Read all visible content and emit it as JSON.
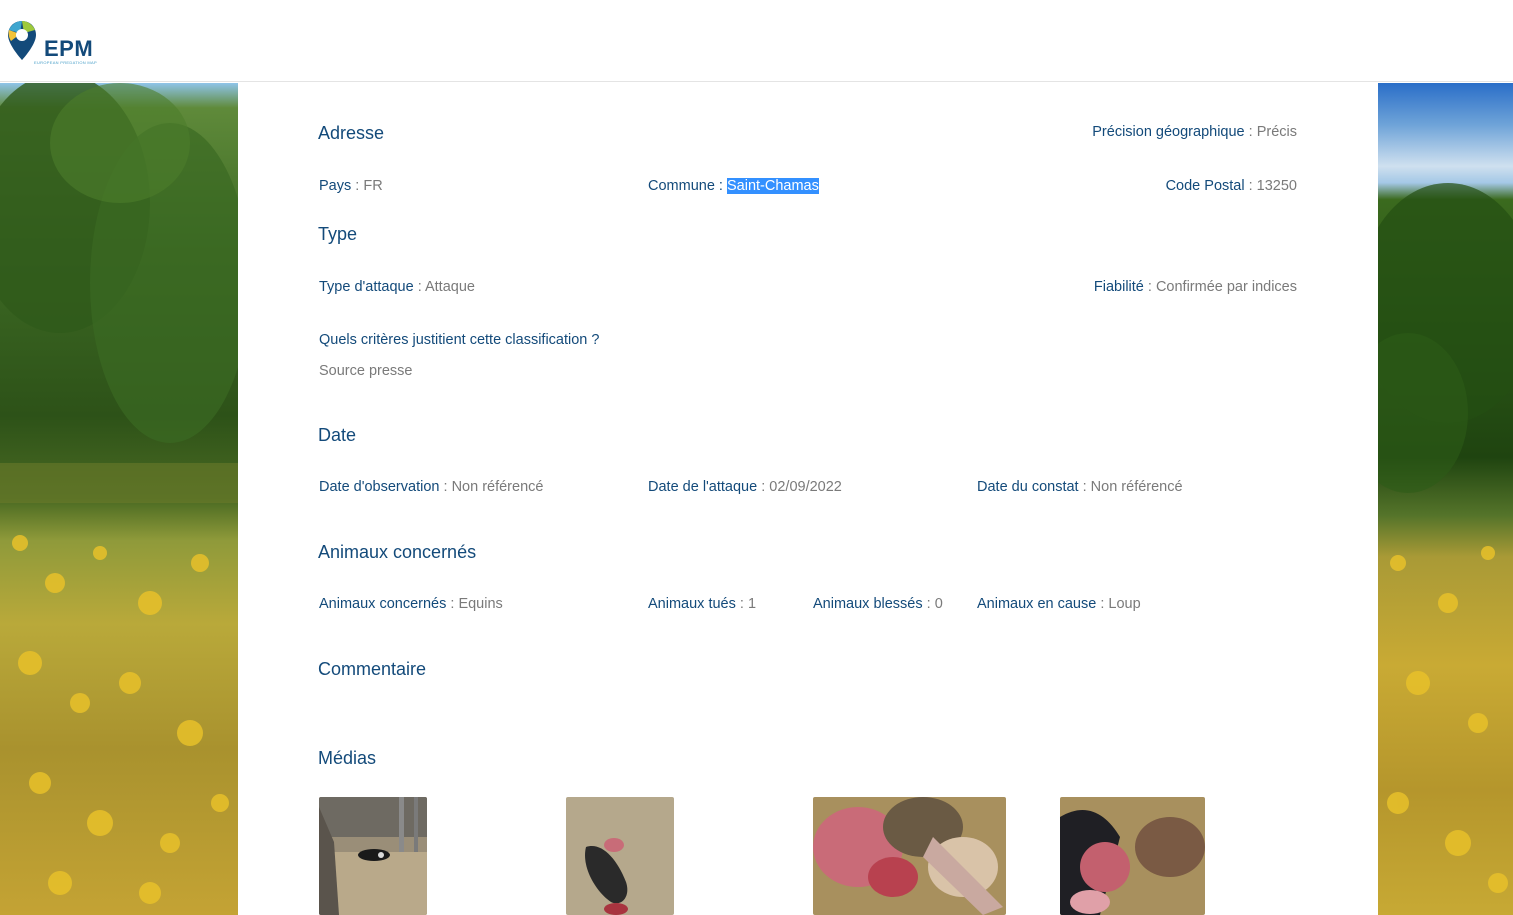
{
  "header": {
    "logo_text": "EPM",
    "logo_tagline": "EUROPEAN PREDATION MAP"
  },
  "adresse": {
    "heading": "Adresse",
    "precision_label": "Précision géographique",
    "precision_value": "Précis",
    "pays_label": "Pays",
    "pays_value": "FR",
    "commune_label": "Commune",
    "commune_value": "Saint-Chamas",
    "code_postal_label": "Code Postal",
    "code_postal_value": "13250"
  },
  "type": {
    "heading": "Type",
    "attaque_label": "Type d'attaque",
    "attaque_value": "Attaque",
    "fiabilite_label": "Fiabilité",
    "fiabilite_value": "Confirmée par indices",
    "question": "Quels critères justitient cette classification ?",
    "answer": "Source presse"
  },
  "date": {
    "heading": "Date",
    "observation_label": "Date d'observation",
    "observation_value": "Non référencé",
    "attaque_label": "Date de l'attaque",
    "attaque_value": "02/09/2022",
    "constat_label": "Date du constat",
    "constat_value": "Non référencé"
  },
  "animaux": {
    "heading": "Animaux concernés",
    "concernes_label": "Animaux concernés",
    "concernes_value": "Equins",
    "tues_label": "Animaux tués",
    "tues_value": "1",
    "blesses_label": "Animaux blessés",
    "blesses_value": "0",
    "cause_label": "Animaux en cause",
    "cause_value": "Loup"
  },
  "commentaire": {
    "heading": "Commentaire"
  },
  "medias": {
    "heading": "Médias",
    "items": [
      {
        "name": "media-photo-1"
      },
      {
        "name": "media-photo-2"
      },
      {
        "name": "media-photo-3"
      },
      {
        "name": "media-photo-4"
      }
    ]
  },
  "colors": {
    "heading": "#134a7a",
    "value": "#7a7a7a",
    "selection": "#3390ff"
  }
}
